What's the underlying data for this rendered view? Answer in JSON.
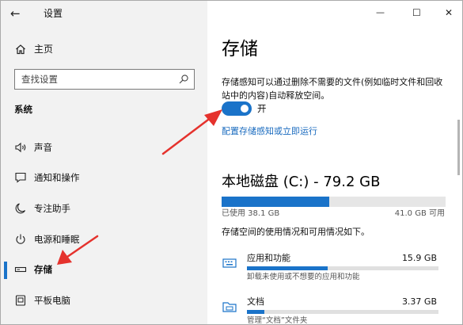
{
  "window": {
    "title": "设置",
    "back_glyph": "←",
    "minimize_glyph": "—",
    "maximize_glyph": "☐",
    "close_glyph": "✕"
  },
  "sidebar": {
    "home_label": "主页",
    "search_placeholder": "查找设置",
    "section_title": "系统",
    "items": [
      {
        "label": "声音",
        "icon": "speaker-icon"
      },
      {
        "label": "通知和操作",
        "icon": "notification-icon"
      },
      {
        "label": "专注助手",
        "icon": "moon-icon"
      },
      {
        "label": "电源和睡眠",
        "icon": "power-icon"
      },
      {
        "label": "存储",
        "icon": "storage-icon",
        "active": true
      },
      {
        "label": "平板电脑",
        "icon": "tablet-icon"
      }
    ]
  },
  "main": {
    "title": "存储",
    "description": "存储感知可以通过删除不需要的文件(例如临时文件和回收站中的内容)自动释放空间。",
    "toggle_state": "开",
    "toggle_on": true,
    "configure_link": "配置存储感知或立即运行",
    "drive": {
      "title": "本地磁盘 (C:) - 79.2 GB",
      "used_label": "已使用 38.1 GB",
      "free_label": "41.0 GB 可用",
      "used_fraction": 0.481
    },
    "usage_note": "存储空间的使用情况和可用情况如下。",
    "categories": [
      {
        "name": "应用和功能",
        "size": "15.9 GB",
        "desc": "卸载未使用或不想要的应用和功能",
        "fraction": 0.42,
        "icon": "keyboard-icon"
      },
      {
        "name": "文档",
        "size": "3.37 GB",
        "desc": "管理“文档”文件夹",
        "fraction": 0.09,
        "icon": "folder-icon"
      }
    ]
  },
  "colors": {
    "accent": "#1a73c9",
    "arrow": "#e5322d",
    "sidebar_bg": "#f2f2f2"
  }
}
